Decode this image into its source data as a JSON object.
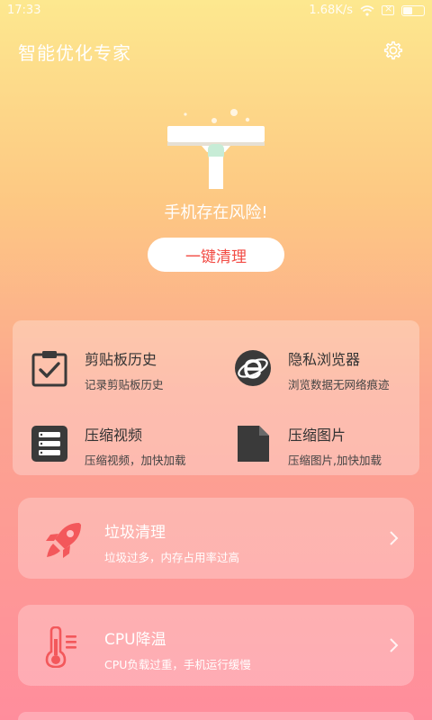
{
  "status": {
    "time": "17:33",
    "speed": "1.68K/s"
  },
  "header": {
    "title": "智能优化专家",
    "settings_icon": "gear-icon"
  },
  "hero": {
    "risk_text": "手机存在风险!",
    "clean_button": "一键清理"
  },
  "tools": [
    {
      "title": "剪贴板历史",
      "subtitle": "记录剪贴板历史",
      "icon": "clipboard-check-icon"
    },
    {
      "title": "隐私浏览器",
      "subtitle": "浏览数据无网络痕迹",
      "icon": "browser-e-icon"
    },
    {
      "title": "压缩视频",
      "subtitle": "压缩视频，加快加载",
      "icon": "server-stack-icon"
    },
    {
      "title": "压缩图片",
      "subtitle": "压缩图片,加快加载",
      "icon": "file-icon"
    }
  ],
  "features": [
    {
      "title": "垃圾清理",
      "subtitle": "垃圾过多，内存占用率过高",
      "icon": "rocket-icon"
    },
    {
      "title": "CPU降温",
      "subtitle": "CPU负载过重，手机运行缓慢",
      "icon": "thermometer-icon"
    }
  ],
  "colors": {
    "accent_red": "#f24b44",
    "icon_pink": "#f3585b",
    "icon_dark": "#3a3a3a"
  }
}
